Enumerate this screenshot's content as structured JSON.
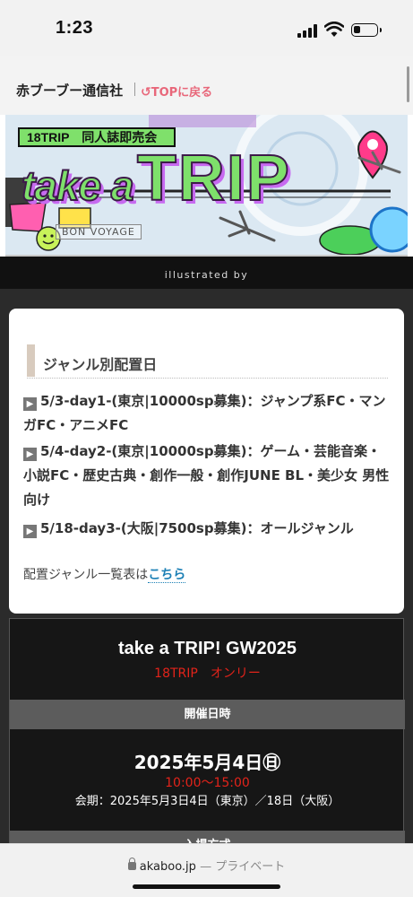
{
  "status": {
    "time": "1:23"
  },
  "header": {
    "site_title": "赤ブーブー通信社",
    "separator": "|",
    "top_icon": "↺",
    "top_label": "TOPに戻る"
  },
  "banner": {
    "badge": "18TRIP　同人誌即売会",
    "take": "take a",
    "trip": "TRIP",
    "voyage": "BON VOYAGE",
    "illustrated": "illustrated by",
    "accent": "#7ee06b",
    "purple": "#c76af0"
  },
  "genre": {
    "heading": "ジャンル別配置日",
    "items": [
      {
        "label": "5/3-day1-(東京|10000sp募集)：ジャンプ系FC・マンガFC・アニメFC"
      },
      {
        "label": "5/4-day2-(東京|10000sp募集)：ゲーム・芸能音楽・小説FC・歴史古典・創作一般・創作JUNE BL・美少女 男性向け"
      },
      {
        "label": "5/18-day3-(大阪|7500sp募集)：オールジャンル"
      }
    ],
    "note_text": "配置ジャンル一覧表は",
    "note_link": "こちら"
  },
  "event": {
    "title": "take a TRIP! GW2025",
    "subtitle": "18TRIP　オンリー",
    "date_head": "開催日時",
    "date": "2025年5月4日㊐",
    "time": "10:00〜15:00",
    "period": "会期：2025年5月3日4日（東京）／18日（大阪）",
    "entry_head": "入場方式"
  },
  "browser": {
    "domain": "akaboo.jp",
    "privacy": "— プライベート"
  }
}
